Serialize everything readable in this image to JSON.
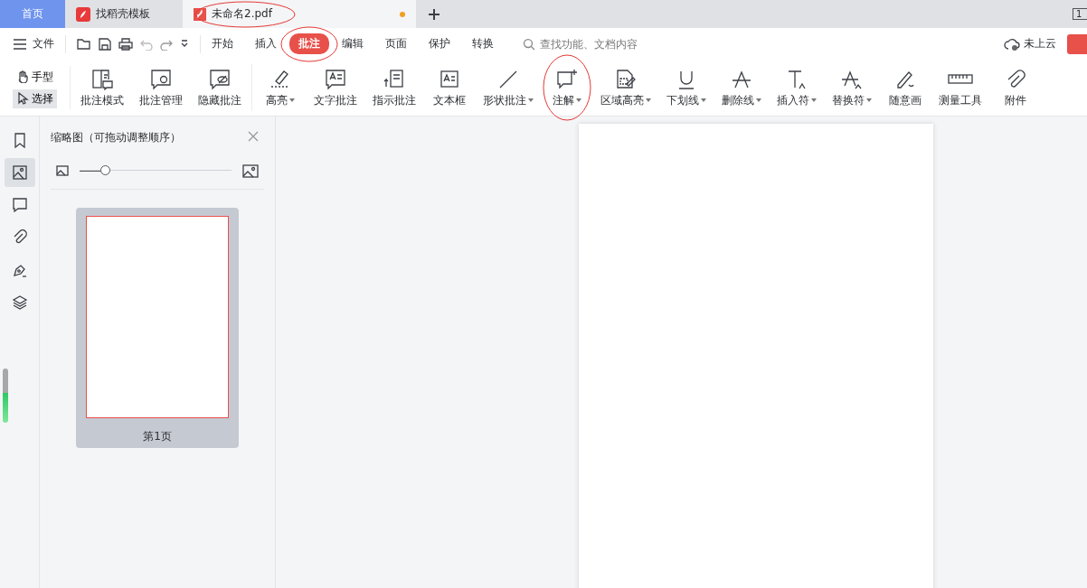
{
  "tabs": [
    {
      "label": "首页",
      "kind": "home",
      "selected": false,
      "circled": false,
      "unsaved": false
    },
    {
      "label": "找稻壳模板",
      "kind": "template",
      "selected": false,
      "circled": false,
      "unsaved": false
    },
    {
      "label": "未命名2.pdf",
      "kind": "pdf",
      "selected": true,
      "circled": true,
      "unsaved": true
    }
  ],
  "corner_badge": "1",
  "menu": {
    "file": "文件",
    "tabs": [
      {
        "label": "开始",
        "selected": false,
        "circled": false
      },
      {
        "label": "插入",
        "selected": false,
        "circled": false
      },
      {
        "label": "批注",
        "selected": true,
        "circled": true
      },
      {
        "label": "编辑",
        "selected": false,
        "circled": false
      },
      {
        "label": "页面",
        "selected": false,
        "circled": false
      },
      {
        "label": "保护",
        "selected": false,
        "circled": false
      },
      {
        "label": "转换",
        "selected": false,
        "circled": false
      }
    ],
    "search": {
      "placeholder": "查找功能、文档内容"
    },
    "cloud": "未上云"
  },
  "ribbon": {
    "modes": [
      {
        "label": "手型",
        "kind": "hand",
        "selected": false
      },
      {
        "label": "选择",
        "kind": "pointer",
        "selected": true
      }
    ],
    "groups": [
      [
        {
          "label": "批注模式",
          "kind": "mode",
          "dropdown": false,
          "circled": false
        },
        {
          "label": "批注管理",
          "kind": "manage",
          "dropdown": false,
          "circled": false
        },
        {
          "label": "隐藏批注",
          "kind": "hide",
          "dropdown": false,
          "circled": false
        }
      ],
      [
        {
          "label": "高亮",
          "kind": "highlight",
          "dropdown": true,
          "circled": false
        },
        {
          "label": "文字批注",
          "kind": "textnote",
          "dropdown": false,
          "circled": false
        },
        {
          "label": "指示批注",
          "kind": "pointnote",
          "dropdown": false,
          "circled": false
        },
        {
          "label": "文本框",
          "kind": "textbox",
          "dropdown": false,
          "circled": false
        },
        {
          "label": "形状批注",
          "kind": "line",
          "dropdown": true,
          "circled": false
        },
        {
          "label": "注解",
          "kind": "note",
          "dropdown": true,
          "circled": true
        },
        {
          "label": "区域高亮",
          "kind": "area",
          "dropdown": true,
          "circled": false
        },
        {
          "label": "下划线",
          "kind": "underline",
          "dropdown": true,
          "circled": false
        },
        {
          "label": "删除线",
          "kind": "strike",
          "dropdown": true,
          "circled": false
        },
        {
          "label": "插入符",
          "kind": "insert",
          "dropdown": true,
          "circled": false
        },
        {
          "label": "替换符",
          "kind": "replace",
          "dropdown": true,
          "circled": false
        },
        {
          "label": "随意画",
          "kind": "pen",
          "dropdown": false,
          "circled": false
        },
        {
          "label": "测量工具",
          "kind": "ruler",
          "dropdown": false,
          "circled": false
        },
        {
          "label": "附件",
          "kind": "clip",
          "dropdown": false,
          "circled": false
        }
      ]
    ]
  },
  "rail": [
    {
      "kind": "bookmark",
      "selected": false
    },
    {
      "kind": "image",
      "selected": true
    },
    {
      "kind": "comment",
      "selected": false
    },
    {
      "kind": "clip",
      "selected": false
    },
    {
      "kind": "sign",
      "selected": false
    },
    {
      "kind": "layers",
      "selected": false
    }
  ],
  "thumbnails": {
    "title": "缩略图（可拖动调整顺序）",
    "zoom": {
      "level": 0.17
    },
    "pages": [
      {
        "label": "第1页",
        "selected": true
      }
    ]
  }
}
